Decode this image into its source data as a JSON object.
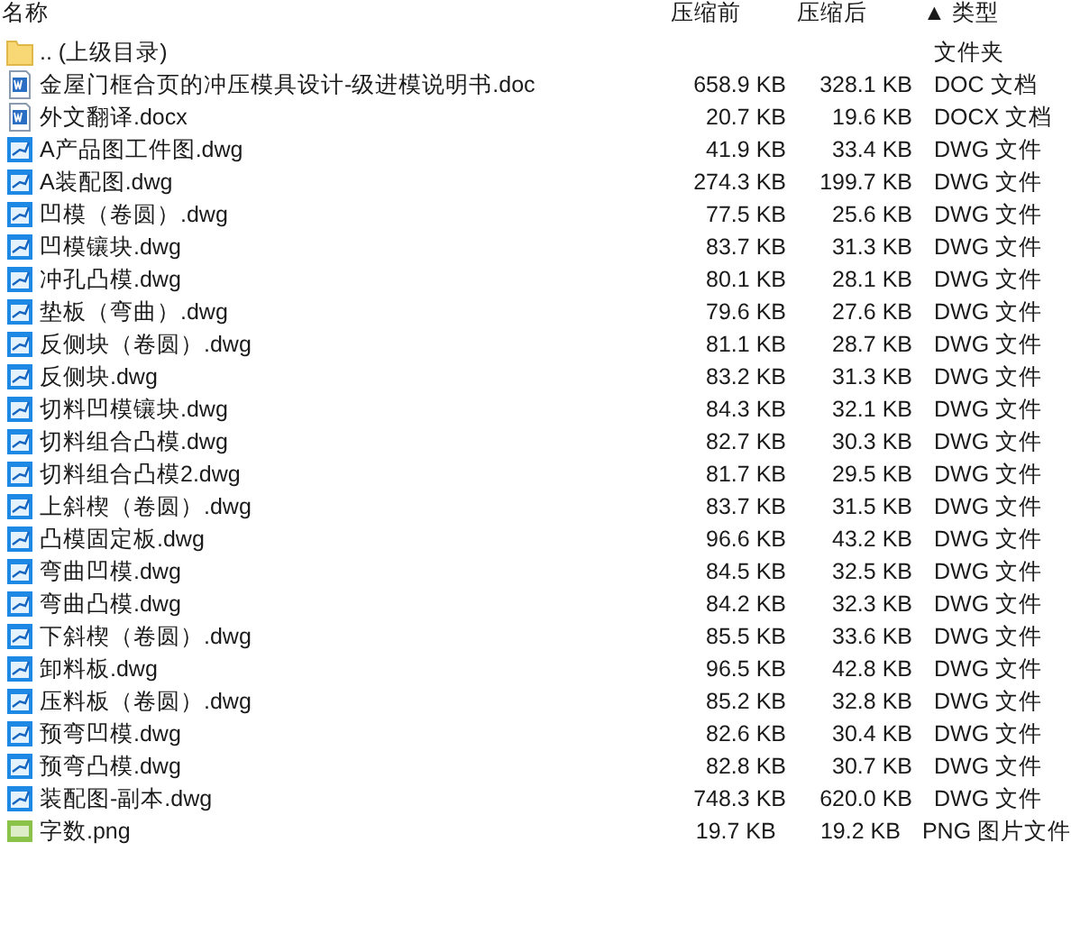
{
  "columns": [
    {
      "label": "名称"
    },
    {
      "label": "压缩前"
    },
    {
      "label": "压缩后"
    },
    {
      "label": "▲ 类型"
    }
  ],
  "rows": [
    {
      "kind": "folder",
      "name": ".. (上级目录)",
      "before": "",
      "after": "",
      "type": "文件夹"
    },
    {
      "kind": "doc",
      "name": "金屋门框合页的冲压模具设计-级进模说明书.doc",
      "before": "658.9 KB",
      "after": "328.1 KB",
      "type": "DOC 文档"
    },
    {
      "kind": "doc",
      "name": "外文翻译.docx",
      "before": "20.7 KB",
      "after": "19.6 KB",
      "type": "DOCX 文档"
    },
    {
      "kind": "dwg",
      "name": "A产品图工件图.dwg",
      "before": "41.9 KB",
      "after": "33.4 KB",
      "type": "DWG 文件"
    },
    {
      "kind": "dwg",
      "name": "A装配图.dwg",
      "before": "274.3 KB",
      "after": "199.7 KB",
      "type": "DWG 文件"
    },
    {
      "kind": "dwg",
      "name": "凹模（卷圆）.dwg",
      "before": "77.5 KB",
      "after": "25.6 KB",
      "type": "DWG 文件"
    },
    {
      "kind": "dwg",
      "name": "凹模镶块.dwg",
      "before": "83.7 KB",
      "after": "31.3 KB",
      "type": "DWG 文件"
    },
    {
      "kind": "dwg",
      "name": "冲孔凸模.dwg",
      "before": "80.1 KB",
      "after": "28.1 KB",
      "type": "DWG 文件"
    },
    {
      "kind": "dwg",
      "name": "垫板（弯曲）.dwg",
      "before": "79.6 KB",
      "after": "27.6 KB",
      "type": "DWG 文件"
    },
    {
      "kind": "dwg",
      "name": "反侧块（卷圆）.dwg",
      "before": "81.1 KB",
      "after": "28.7 KB",
      "type": "DWG 文件"
    },
    {
      "kind": "dwg",
      "name": "反侧块.dwg",
      "before": "83.2 KB",
      "after": "31.3 KB",
      "type": "DWG 文件"
    },
    {
      "kind": "dwg",
      "name": "切料凹模镶块.dwg",
      "before": "84.3 KB",
      "after": "32.1 KB",
      "type": "DWG 文件"
    },
    {
      "kind": "dwg",
      "name": "切料组合凸模.dwg",
      "before": "82.7 KB",
      "after": "30.3 KB",
      "type": "DWG 文件"
    },
    {
      "kind": "dwg",
      "name": "切料组合凸模2.dwg",
      "before": "81.7 KB",
      "after": "29.5 KB",
      "type": "DWG 文件"
    },
    {
      "kind": "dwg",
      "name": "上斜楔（卷圆）.dwg",
      "before": "83.7 KB",
      "after": "31.5 KB",
      "type": "DWG 文件"
    },
    {
      "kind": "dwg",
      "name": "凸模固定板.dwg",
      "before": "96.6 KB",
      "after": "43.2 KB",
      "type": "DWG 文件"
    },
    {
      "kind": "dwg",
      "name": "弯曲凹模.dwg",
      "before": "84.5 KB",
      "after": "32.5 KB",
      "type": "DWG 文件"
    },
    {
      "kind": "dwg",
      "name": "弯曲凸模.dwg",
      "before": "84.2 KB",
      "after": "32.3 KB",
      "type": "DWG 文件"
    },
    {
      "kind": "dwg",
      "name": "下斜楔（卷圆）.dwg",
      "before": "85.5 KB",
      "after": "33.6 KB",
      "type": "DWG 文件"
    },
    {
      "kind": "dwg",
      "name": "卸料板.dwg",
      "before": "96.5 KB",
      "after": "42.8 KB",
      "type": "DWG 文件"
    },
    {
      "kind": "dwg",
      "name": "压料板（卷圆）.dwg",
      "before": "85.2 KB",
      "after": "32.8 KB",
      "type": "DWG 文件"
    },
    {
      "kind": "dwg",
      "name": "预弯凹模.dwg",
      "before": "82.6 KB",
      "after": "30.4 KB",
      "type": "DWG 文件"
    },
    {
      "kind": "dwg",
      "name": "预弯凸模.dwg",
      "before": "82.8 KB",
      "after": "30.7 KB",
      "type": "DWG 文件"
    },
    {
      "kind": "dwg",
      "name": "装配图-副本.dwg",
      "before": "748.3 KB",
      "after": "620.0 KB",
      "type": "DWG 文件"
    },
    {
      "kind": "png",
      "name": "字数.png",
      "before": "19.7 KB",
      "after": "19.2 KB",
      "type": "PNG 图片文件"
    }
  ]
}
